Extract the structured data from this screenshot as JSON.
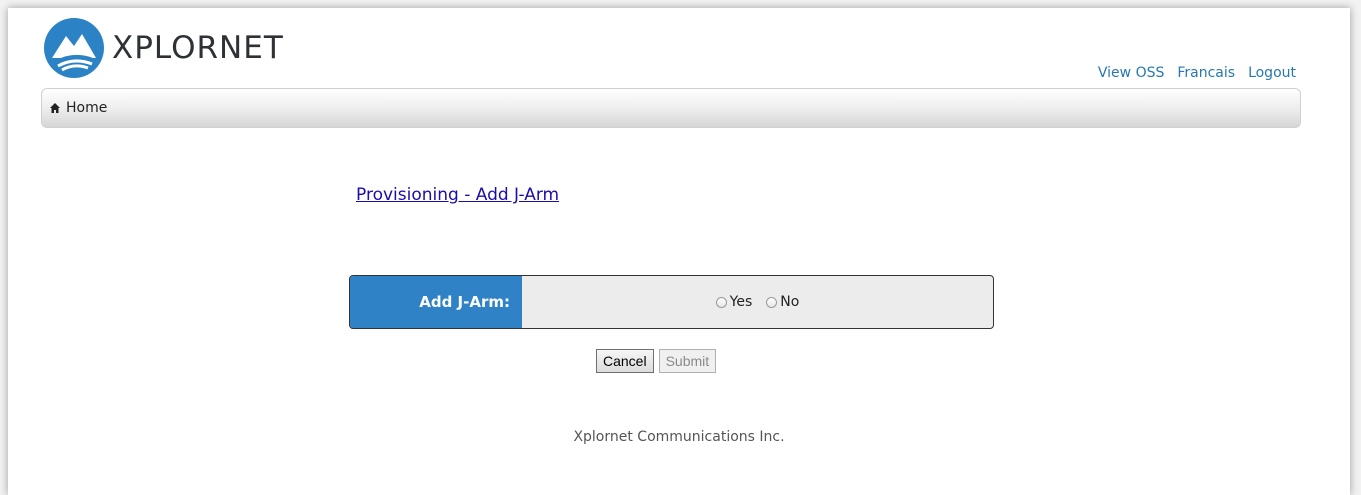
{
  "brand": {
    "name": "XPLORNET"
  },
  "top_nav": {
    "view_oss": "View OSS",
    "language": "Francais",
    "logout": "Logout"
  },
  "breadcrumb": {
    "home_icon": "home-icon",
    "home": "Home"
  },
  "page": {
    "title": "Provisioning - Add J-Arm"
  },
  "form": {
    "field_label": "Add J-Arm:",
    "options": [
      {
        "label": "Yes",
        "selected": false
      },
      {
        "label": "No",
        "selected": false
      }
    ]
  },
  "actions": {
    "cancel": "Cancel",
    "submit": "Submit",
    "submit_disabled": true
  },
  "footer": {
    "company": "Xplornet Communications Inc."
  },
  "colors": {
    "accent_blue": "#2f82c6",
    "link_blue": "#2678b0",
    "title_link": "#1a0dab"
  }
}
